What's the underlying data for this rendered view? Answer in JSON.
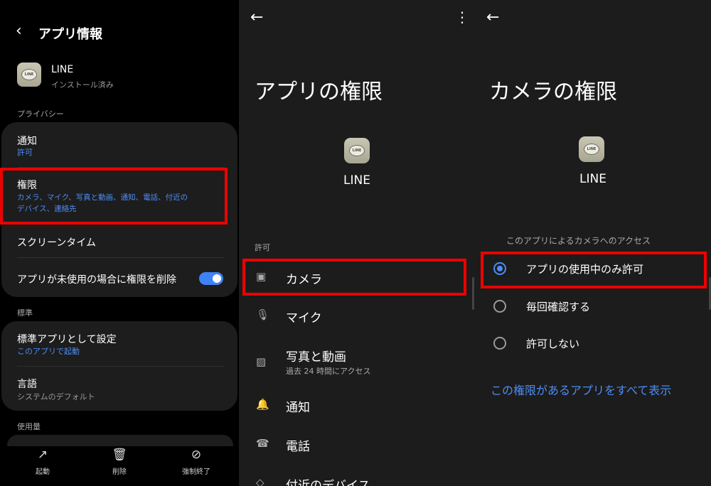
{
  "panel1": {
    "title": "アプリ情報",
    "app": {
      "name": "LINE",
      "status": "インストール済み",
      "icon_text": "LINE"
    },
    "privacy_header": "プライバシー",
    "notifications": {
      "title": "通知",
      "sub": "許可"
    },
    "permissions": {
      "title": "権限",
      "sub_line1": "カメラ、マイク、写真と動画、通知、電話、付近の",
      "sub_line2": "デバイス、連絡先"
    },
    "screen_time": "スクリーンタイム",
    "remove_permissions": {
      "label": "アプリが未使用の場合に権限を削除",
      "enabled": true
    },
    "standard_header": "標準",
    "default_app": {
      "title": "標準アプリとして設定",
      "sub": "このアプリで起動"
    },
    "language": {
      "title": "言語",
      "sub": "システムのデフォルト"
    },
    "usage_header": "使用量",
    "bottom_bar": [
      {
        "icon": "open-icon",
        "label": "起動"
      },
      {
        "icon": "trash-icon",
        "label": "削除"
      },
      {
        "icon": "force-stop-icon",
        "label": "強制終了"
      }
    ]
  },
  "panel2": {
    "title": "アプリの権限",
    "app_name": "LINE",
    "allowed_header": "許可",
    "items": [
      {
        "icon": "camera-icon",
        "label": "カメラ",
        "sub": ""
      },
      {
        "icon": "mic-icon",
        "label": "マイク",
        "sub": ""
      },
      {
        "icon": "photo-icon",
        "label": "写真と動画",
        "sub": "過去 24 時間にアクセス"
      },
      {
        "icon": "bell-icon",
        "label": "通知",
        "sub": ""
      },
      {
        "icon": "phone-icon",
        "label": "電話",
        "sub": ""
      },
      {
        "icon": "nearby-icon",
        "label": "付近のデバイス",
        "sub": ""
      }
    ]
  },
  "panel3": {
    "title": "カメラの権限",
    "app_name": "LINE",
    "access_header": "このアプリによるカメラへのアクセス",
    "options": [
      {
        "label": "アプリの使用中のみ許可",
        "selected": true
      },
      {
        "label": "毎回確認する",
        "selected": false
      },
      {
        "label": "許可しない",
        "selected": false
      }
    ],
    "link": "この権限があるアプリをすべて表示"
  },
  "colors": {
    "accent": "#4c8df6",
    "highlight": "#ee0000",
    "panel_bg": "#1c1c1c"
  }
}
